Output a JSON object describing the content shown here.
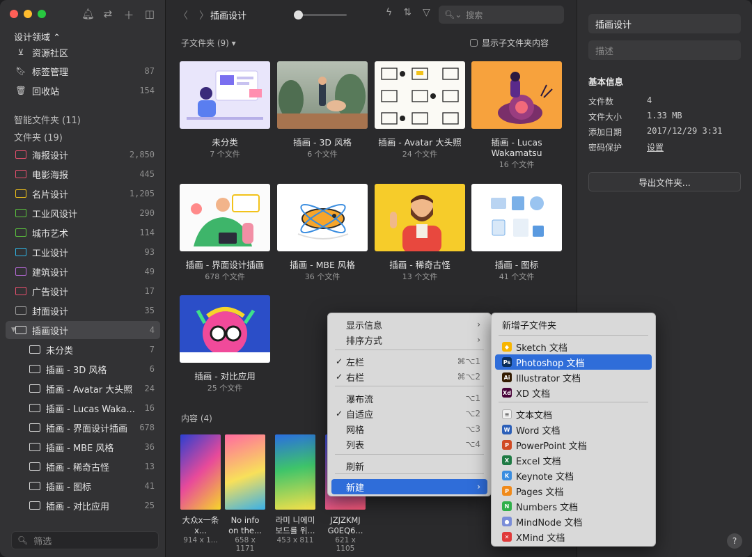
{
  "sidebar": {
    "library": "设计领域 ⌃",
    "top_items": [
      {
        "label": "资源社区",
        "count": ""
      },
      {
        "label": "标签管理",
        "count": "87"
      },
      {
        "label": "回收站",
        "count": "154"
      }
    ],
    "smart_folders": "智能文件夹 (11)",
    "folders_head": "文件夹 (19)",
    "folders": [
      {
        "label": "海报设计",
        "count": "2,850",
        "color": "#e8506e"
      },
      {
        "label": "电影海报",
        "count": "445",
        "color": "#e8506e"
      },
      {
        "label": "名片设计",
        "count": "1,205",
        "color": "#f2c21a"
      },
      {
        "label": "工业风设计",
        "count": "290",
        "color": "#5cc43e"
      },
      {
        "label": "城市艺术",
        "count": "114",
        "color": "#5cc43e"
      },
      {
        "label": "工业设计",
        "count": "93",
        "color": "#2fb6e6"
      },
      {
        "label": "建筑设计",
        "count": "49",
        "color": "#b76ad8"
      },
      {
        "label": "广告设计",
        "count": "17",
        "color": "#e8506e"
      },
      {
        "label": "封面设计",
        "count": "35",
        "color": "#9a9a9a"
      },
      {
        "label": "插画设计",
        "count": "4",
        "color": "#d8d8d8"
      }
    ],
    "subfolders": [
      {
        "label": "未分类",
        "count": "7"
      },
      {
        "label": "插画 - 3D 风格",
        "count": "6"
      },
      {
        "label": "插画 - Avatar 大头照",
        "count": "24"
      },
      {
        "label": "插画 - Lucas Waka...",
        "count": "16"
      },
      {
        "label": "插画 - 界面设计插画",
        "count": "678"
      },
      {
        "label": "插画 - MBE 风格",
        "count": "36"
      },
      {
        "label": "插画 - 稀奇古怪",
        "count": "13"
      },
      {
        "label": "插画 - 图标",
        "count": "41"
      },
      {
        "label": "插画 - 对比应用",
        "count": "25"
      }
    ],
    "filter_placeholder": "筛选"
  },
  "toolbar": {
    "title": "插画设计",
    "search_placeholder": "搜索"
  },
  "main": {
    "subfolders_label": "子文件夹 (9)",
    "show_subfolder_content": "显示子文件夹内容",
    "tiles": [
      {
        "name": "未分类",
        "sub": "7 个文件"
      },
      {
        "name": "插画 - 3D 风格",
        "sub": "6 个文件"
      },
      {
        "name": "插画 - Avatar 大头照",
        "sub": "24 个文件"
      },
      {
        "name": "插画 - Lucas Wakamatsu",
        "sub": "16 个文件"
      },
      {
        "name": "插画 - 界面设计插画",
        "sub": "678 个文件"
      },
      {
        "name": "插画 - MBE 风格",
        "sub": "36 个文件"
      },
      {
        "name": "插画 - 稀奇古怪",
        "sub": "13 个文件"
      },
      {
        "name": "插画 - 图标",
        "sub": "41 个文件"
      },
      {
        "name": "插画 - 对比应用",
        "sub": "25 个文件"
      }
    ],
    "content_label": "内容 (4)",
    "content": [
      {
        "name": "大众x一条x...",
        "sub": "914 x 1..."
      },
      {
        "name": "No info on the...",
        "sub": "658 x 1171"
      },
      {
        "name": "라미 니에미 보드를 위...",
        "sub": "453 x 811"
      },
      {
        "name": "JZJZKMJ G0EQ6...",
        "sub": "621 x 1105"
      }
    ]
  },
  "inspector": {
    "title": "插画设计",
    "desc_placeholder": "描述",
    "section": "基本信息",
    "rows": [
      {
        "label": "文件数",
        "value": "4"
      },
      {
        "label": "文件大小",
        "value": "1.33 MB"
      },
      {
        "label": "添加日期",
        "value": "2017/12/29 3:31"
      },
      {
        "label": "密码保护",
        "value": "设置"
      }
    ],
    "export": "导出文件夹...",
    "help": "?"
  },
  "context_menu": {
    "items": [
      {
        "label": "显示信息",
        "kbd": "",
        "checked": false
      },
      {
        "label": "排序方式",
        "kbd": "",
        "checked": false
      },
      {
        "label": "左栏",
        "kbd": "⌘⌥1",
        "checked": true
      },
      {
        "label": "右栏",
        "kbd": "⌘⌥2",
        "checked": true
      },
      {
        "label": "瀑布流",
        "kbd": "⌥1",
        "checked": false
      },
      {
        "label": "自适应",
        "kbd": "⌥2",
        "checked": true
      },
      {
        "label": "网格",
        "kbd": "⌥3",
        "checked": false
      },
      {
        "label": "列表",
        "kbd": "⌥4",
        "checked": false
      },
      {
        "label": "刷新",
        "kbd": "",
        "checked": false
      },
      {
        "label": "新建",
        "kbd": "",
        "checked": false
      }
    ]
  },
  "new_menu": {
    "new_subfolder": "新增子文件夹",
    "apps": [
      {
        "label": "Sketch 文档",
        "icon": "sketch-icon",
        "color": "#f7b500",
        "glyph": "◆"
      },
      {
        "label": "Photoshop 文档",
        "icon": "photoshop-icon",
        "color": "#0a2d5a",
        "glyph": "Ps"
      },
      {
        "label": "Illustrator 文档",
        "icon": "illustrator-icon",
        "color": "#331b00",
        "glyph": "Ai"
      },
      {
        "label": "XD 文档",
        "icon": "xd-icon",
        "color": "#470137",
        "glyph": "Xd"
      }
    ],
    "docs": [
      {
        "label": "文本文档",
        "icon": "text-doc-icon",
        "color": "#f0f0f0",
        "glyph": "≡"
      },
      {
        "label": "Word 文档",
        "icon": "word-icon",
        "color": "#2b5fb8",
        "glyph": "W"
      },
      {
        "label": "PowerPoint 文档",
        "icon": "powerpoint-icon",
        "color": "#d04a23",
        "glyph": "P"
      },
      {
        "label": "Excel 文档",
        "icon": "excel-icon",
        "color": "#1f7a44",
        "glyph": "X"
      },
      {
        "label": "Keynote 文档",
        "icon": "keynote-icon",
        "color": "#3a8de0",
        "glyph": "K"
      },
      {
        "label": "Pages 文档",
        "icon": "pages-icon",
        "color": "#f08a1a",
        "glyph": "P"
      },
      {
        "label": "Numbers 文档",
        "icon": "numbers-icon",
        "color": "#30b04a",
        "glyph": "N"
      },
      {
        "label": "MindNode 文档",
        "icon": "mindnode-icon",
        "color": "#7a8dd8",
        "glyph": "●"
      },
      {
        "label": "XMind 文档",
        "icon": "xmind-icon",
        "color": "#e03a3a",
        "glyph": "✕"
      }
    ]
  }
}
